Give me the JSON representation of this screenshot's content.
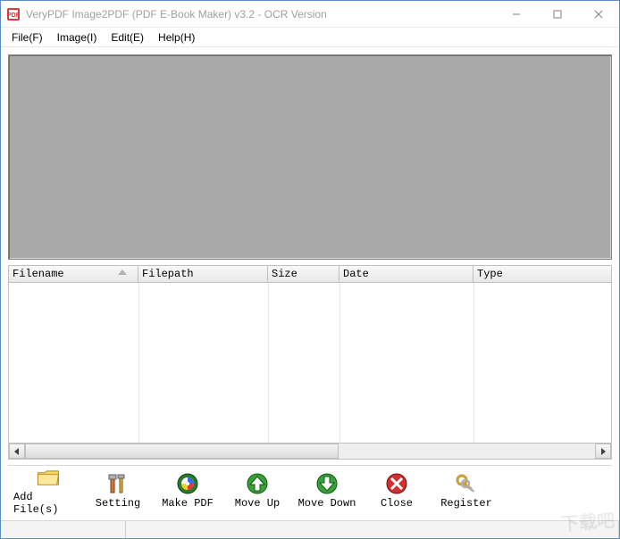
{
  "window": {
    "title": "VeryPDF Image2PDF (PDF E-Book Maker) v3.2 - OCR Version"
  },
  "menu": {
    "file": "File(F)",
    "image": "Image(I)",
    "edit": "Edit(E)",
    "help": "Help(H)"
  },
  "table": {
    "columns": {
      "filename": "Filename",
      "filepath": "Filepath",
      "size": "Size",
      "date": "Date",
      "type": "Type"
    },
    "rows": []
  },
  "toolbar": {
    "add_files": "Add File(s)",
    "setting": "Setting",
    "make_pdf": "Make PDF",
    "move_up": "Move Up",
    "move_down": "Move Down",
    "close": "Close",
    "register": "Register"
  },
  "watermark": "下载吧"
}
